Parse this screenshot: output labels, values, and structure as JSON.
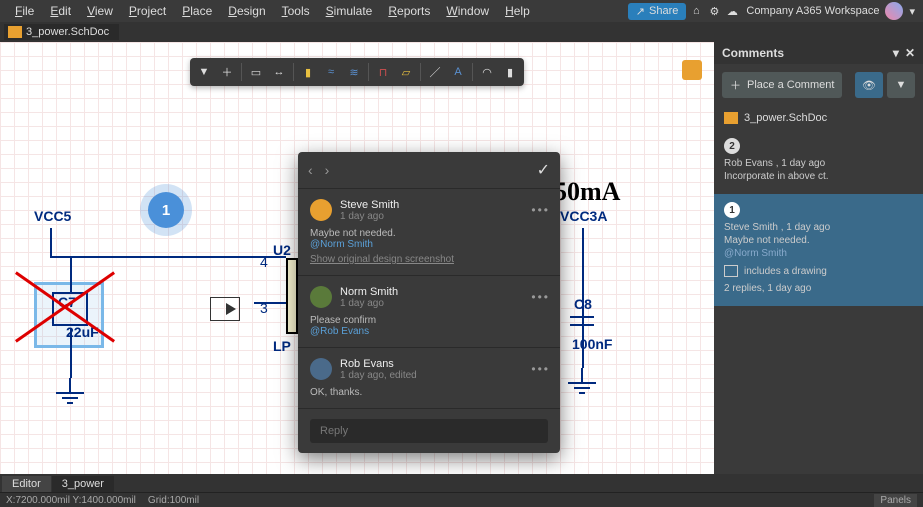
{
  "menu": {
    "file": "File",
    "edit": "Edit",
    "view": "View",
    "project": "Project",
    "place": "Place",
    "design": "Design",
    "tools": "Tools",
    "simulate": "Simulate",
    "reports": "Reports",
    "window": "Window",
    "help": "Help"
  },
  "header": {
    "share": "Share",
    "workspace": "Company A365 Workspace"
  },
  "doc": {
    "tab": "3_power.SchDoc"
  },
  "schematic": {
    "net_left": "VCC5",
    "net_right": "VCC3A",
    "current_text": "50mA",
    "u2_ref": "U2",
    "u2_type": "LP",
    "c7_ref": "C7",
    "c7_val": "22uF",
    "c8_ref": "C8",
    "c8_val": "100nF",
    "pin4": "4",
    "pin3": "3",
    "ann1": "1"
  },
  "thread": {
    "check": "✓",
    "c1": {
      "user": "Steve Smith",
      "date": "1 day ago",
      "body": "Maybe not needed.",
      "mention": "@Norm Smith",
      "link": "Show original design screenshot"
    },
    "c2": {
      "user": "Norm Smith",
      "date": "1 day ago",
      "body": "Please confirm",
      "mention": "@Rob Evans"
    },
    "c3": {
      "user": "Rob Evans",
      "date": "1 day ago, edited",
      "body": "OK, thanks."
    },
    "reply": "Reply"
  },
  "panel": {
    "title": "Comments",
    "place": "Place a Comment",
    "file": "3_power.SchDoc",
    "item2": {
      "num": "2",
      "meta": "Rob Evans , 1 day ago",
      "body": "Incorporate in above ct."
    },
    "item1": {
      "num": "1",
      "meta": "Steve Smith , 1 day ago",
      "body": "Maybe not needed.",
      "mention": "@Norm Smith",
      "drawing": "includes a drawing",
      "replies": "2 replies, 1 day ago"
    }
  },
  "footer": {
    "editor": "Editor",
    "tab2": "3_power",
    "coords": "X:7200.000mil Y:1400.000mil",
    "grid": "Grid:100mil",
    "panels": "Panels"
  }
}
